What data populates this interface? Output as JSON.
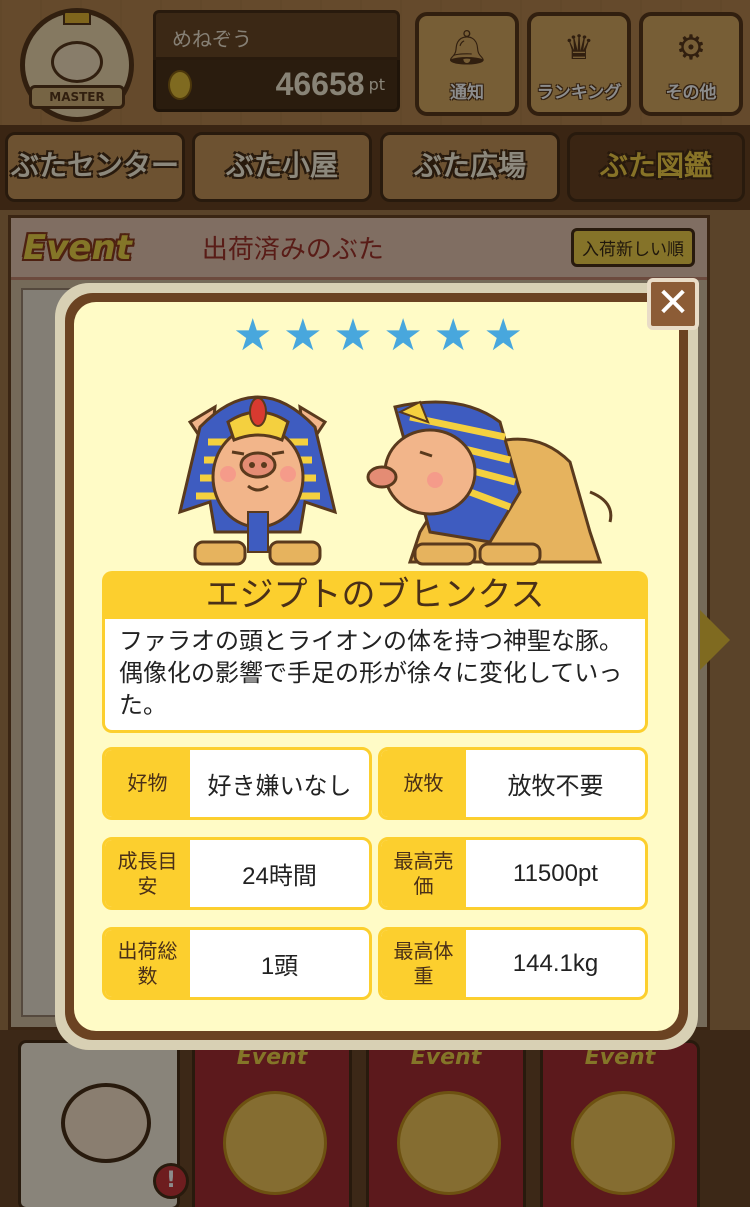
{
  "header": {
    "badge_label": "MASTER",
    "username": "めねぞう",
    "points": "46658",
    "points_unit": "pt",
    "buttons": [
      {
        "label": "通知",
        "icon": "bell-icon"
      },
      {
        "label": "ランキング",
        "icon": "crown-icon"
      },
      {
        "label": "その他",
        "icon": "gear-icon"
      }
    ]
  },
  "tabs": [
    {
      "label": "ぶたセンター",
      "active": false
    },
    {
      "label": "ぶた小屋",
      "active": false
    },
    {
      "label": "ぶた広場",
      "active": false
    },
    {
      "label": "ぶた図鑑",
      "active": true
    }
  ],
  "panel": {
    "event_logo": "Event",
    "title": "出荷済みのぶた",
    "sort_label": "入荷新しい順"
  },
  "bottom": {
    "event_labels": [
      "Event",
      "Event",
      "Event"
    ],
    "alert": "!"
  },
  "modal": {
    "close_label": "✕",
    "rating": 6,
    "stars": [
      "★",
      "★",
      "★",
      "★",
      "★",
      "★"
    ],
    "name": "エジプトのブヒンクス",
    "description": "ファラオの頭とライオンの体を持つ神聖な豚。偶像化の影響で手足の形が徐々に変化していった。",
    "stats": [
      {
        "key": "好物",
        "value": "好き嫌いなし"
      },
      {
        "key": "放牧",
        "value": "放牧不要"
      },
      {
        "key": "成長目安",
        "value": "24時間"
      },
      {
        "key": "最高売価",
        "value": "11500pt"
      },
      {
        "key": "出荷総数",
        "value": "1頭"
      },
      {
        "key": "最高体重",
        "value": "144.1kg"
      }
    ]
  },
  "colors": {
    "star": "#48a7dd",
    "accent_yellow": "#fccf2e",
    "card_bg": "#fffbc6",
    "frame_brown": "#6b4322"
  }
}
